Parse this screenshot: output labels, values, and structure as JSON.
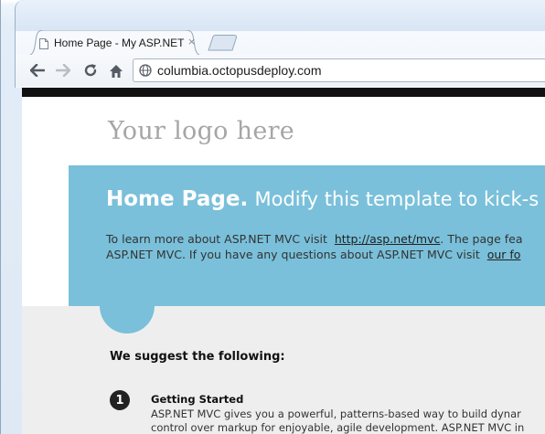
{
  "browser": {
    "tab_title": "Home Page - My ASP.NET",
    "tab_close": "×",
    "url": "columbia.octopusdeploy.com",
    "icons": [
      "back-arrow-icon",
      "forward-arrow-icon",
      "reload-icon",
      "home-icon",
      "globe-icon",
      "page-favicon-icon"
    ]
  },
  "page": {
    "logo_text": "Your logo here",
    "featured": {
      "title_strong": "Home Page.",
      "title_rest": "Modify this template to kick-s",
      "line1_text": "To learn more about ASP.NET MVC visit",
      "line1_link": "http://asp.net/mvc",
      "line1_after": ". The page fea",
      "line2_text": "ASP.NET MVC. If you have any questions about ASP.NET MVC visit",
      "line2_link": "our fo",
      "background_color": "#7ac0da"
    },
    "suggest_heading": "We suggest the following:",
    "items": [
      {
        "number": "1",
        "title": "Getting Started",
        "desc_line1": "ASP.NET MVC gives you a powerful, patterns-based way to build dynar",
        "desc_line2": "control over markup for enjoyable, agile development. ASP.NET MVC in"
      }
    ]
  }
}
